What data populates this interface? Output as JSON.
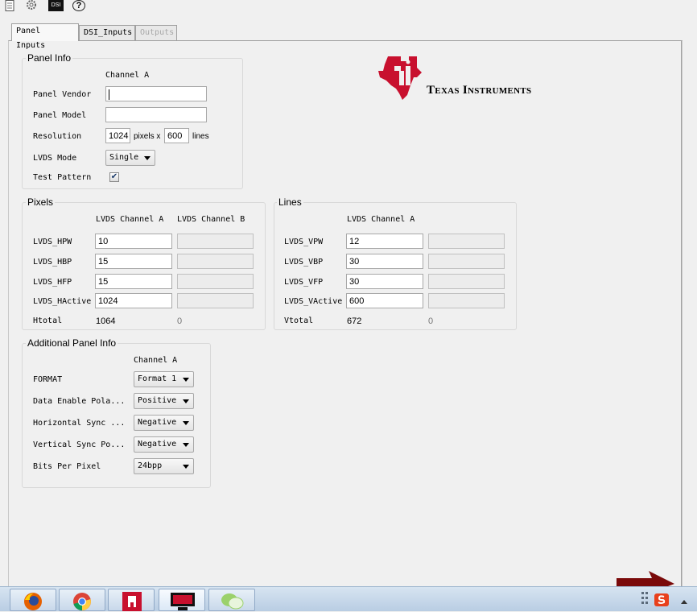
{
  "toolbar": {
    "items": [
      {
        "name": "document-icon"
      },
      {
        "name": "gear-icon"
      },
      {
        "name": "dsi-icon",
        "label": "DSI"
      },
      {
        "name": "help-icon",
        "label": "?"
      }
    ]
  },
  "tabs": [
    {
      "label": "Panel Inputs",
      "state": "active"
    },
    {
      "label": "DSI_Inputs",
      "state": "normal"
    },
    {
      "label": "Outputs",
      "state": "disabled"
    }
  ],
  "logo": {
    "text": "Texas Instruments",
    "color": "#c8102e"
  },
  "panel_info": {
    "title": "Panel Info",
    "channel_header": "Channel A",
    "vendor_label": "Panel Vendor",
    "vendor_value": "",
    "model_label": "Panel Model",
    "model_value": "",
    "resolution_label": "Resolution",
    "res_x": "1024",
    "pixels_x_label": "pixels x",
    "res_y": "600",
    "lines_label": "lines",
    "lvds_mode_label": "LVDS Mode",
    "lvds_mode_value": "Single",
    "test_pattern_label": "Test Pattern",
    "test_pattern_checked": true
  },
  "pixels": {
    "title": "Pixels",
    "col_a": "LVDS Channel A",
    "col_b": "LVDS Channel B",
    "rows": [
      {
        "label": "LVDS_HPW",
        "a": "10",
        "b": ""
      },
      {
        "label": "LVDS_HBP",
        "a": "15",
        "b": ""
      },
      {
        "label": "LVDS_HFP",
        "a": "15",
        "b": ""
      },
      {
        "label": "LVDS_HActive",
        "a": "1024",
        "b": ""
      }
    ],
    "total_label": "Htotal",
    "total_a": "1064",
    "total_b": "0"
  },
  "lines": {
    "title": "Lines",
    "col_a": "LVDS Channel A",
    "rows": [
      {
        "label": "LVDS_VPW",
        "a": "12",
        "b": ""
      },
      {
        "label": "LVDS_VBP",
        "a": "30",
        "b": ""
      },
      {
        "label": "LVDS_VFP",
        "a": "30",
        "b": ""
      },
      {
        "label": "LVDS_VActive",
        "a": "600",
        "b": ""
      }
    ],
    "total_label": "Vtotal",
    "total_a": "672",
    "total_b": "0"
  },
  "additional": {
    "title": "Additional Panel Info",
    "channel_header": "Channel A",
    "rows": [
      {
        "label": "FORMAT",
        "value": "Format 1"
      },
      {
        "label": "Data Enable Pola...",
        "value": "Positive"
      },
      {
        "label": "Horizontal Sync ...",
        "value": "Negative"
      },
      {
        "label": "Vertical Sync Po...",
        "value": "Negative"
      },
      {
        "label": "Bits Per Pixel",
        "value": "24bpp"
      }
    ]
  },
  "taskbar": {
    "apps": [
      "firefox-icon",
      "chrome-icon",
      "ti-usb-icon",
      "ti-display-icon",
      "wechat-icon"
    ],
    "tray": [
      "network-icon",
      "sogou-ime-icon",
      "show-hidden-icons-arrow"
    ],
    "annotation": "red-arrow-icon"
  }
}
